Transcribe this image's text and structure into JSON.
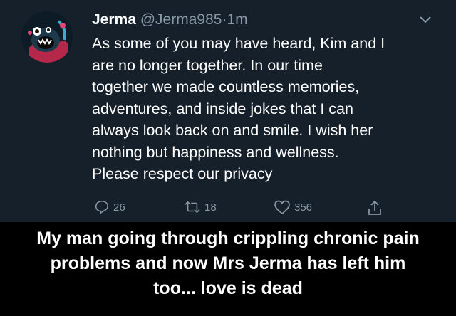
{
  "tweet": {
    "author_name": "Jerma",
    "handle": "@Jerma985",
    "separator": "·",
    "time": "1m",
    "text_lines": [
      "As some of you may have heard, Kim and I",
      "are no longer together. In our time",
      "together we made countless memories,",
      "adventures, and inside jokes that I can",
      "always look back on and smile. I wish her",
      "nothing but happiness and wellness.",
      "Please respect our privacy"
    ],
    "actions": {
      "reply_count": "26",
      "retweet_count": "18",
      "like_count": "356"
    }
  },
  "caption": {
    "lines": [
      "My man going through crippling chronic pain",
      "problems and now Mrs Jerma has left him",
      "too... love is dead"
    ]
  },
  "colors": {
    "tweet_background": "#15202b",
    "secondary_text": "#8899a6",
    "page_background": "#000000"
  }
}
